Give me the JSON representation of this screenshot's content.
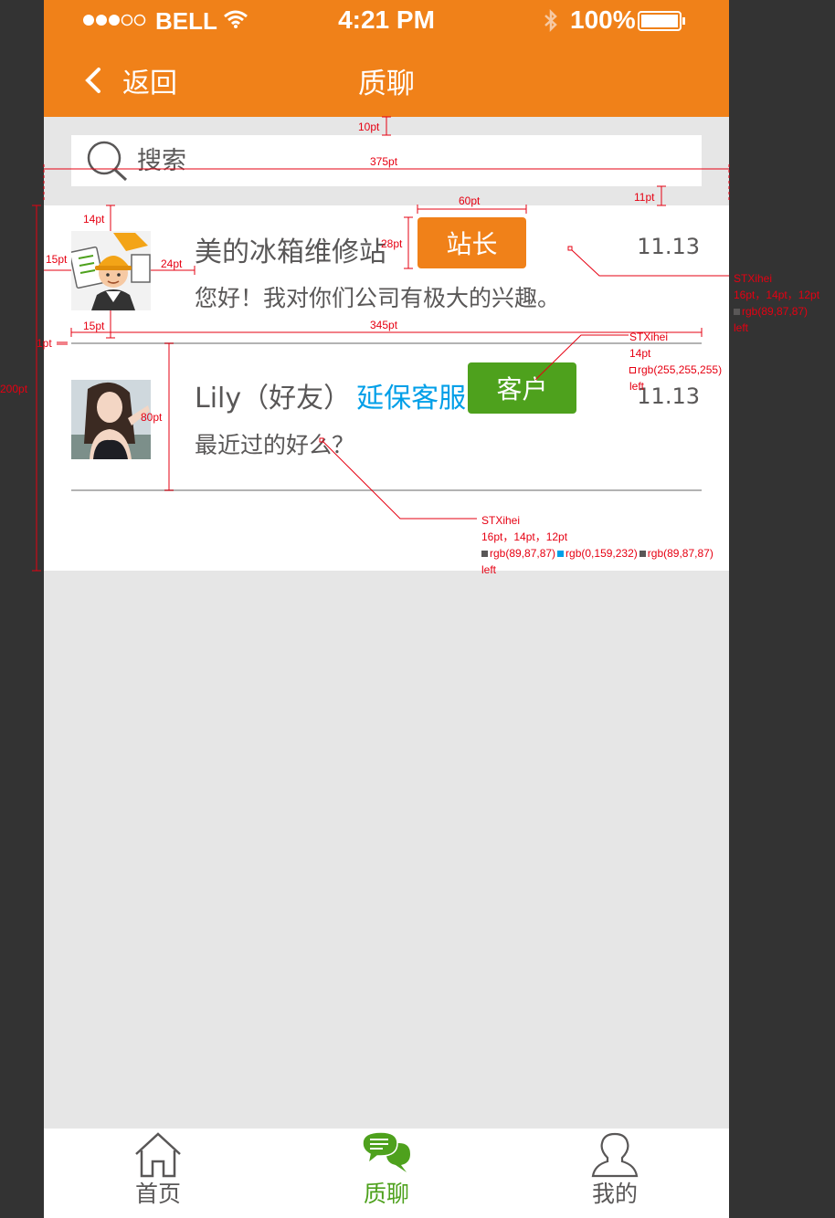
{
  "status_bar": {
    "carrier": "BELL",
    "time": "4:21 PM",
    "battery": "100%"
  },
  "nav": {
    "back_label": "返回",
    "title": "质聊"
  },
  "search": {
    "placeholder": "搜索"
  },
  "conversations": [
    {
      "name": "美的冰箱维修站",
      "role": "",
      "badge": "站长",
      "badge_color": "#f08119",
      "date": "11.13",
      "message": "您好！我对你们公司有极大的兴趣。"
    },
    {
      "name": "Lily（好友）",
      "role": "延保客服",
      "badge": "客户",
      "badge_color": "#4ea11d",
      "date": "11.13",
      "message": "最近过的好么？"
    }
  ],
  "tabs": [
    {
      "label": "首页",
      "icon": "home-icon",
      "active": false
    },
    {
      "label": "质聊",
      "icon": "chat-icon",
      "active": true
    },
    {
      "label": "我的",
      "icon": "user-icon",
      "active": false
    }
  ],
  "annotations": {
    "search_gap": "10pt",
    "width_total": "375pt",
    "badge_width": "60pt",
    "list_gap": "11pt",
    "avatar_top": "14pt",
    "avatar_left": "15pt",
    "avatar_gap": "24pt",
    "badge_height": "28pt",
    "avatar_bottom": "15pt",
    "row_width": "345pt",
    "divider_height": "1pt",
    "row_height": "80pt",
    "list_height": "200pt",
    "spec1": {
      "font": "STXihei",
      "size": "16pt，14pt，12pt",
      "color": "rgb(89,87,87)",
      "align": "left"
    },
    "spec2": {
      "font": "STXihei",
      "size": "14pt",
      "color": "rgb(255,255,255)",
      "align": "left"
    },
    "spec3": {
      "font": "STXihei",
      "size": "16pt，14pt，12pt",
      "color_a": "rgb(89,87,87)",
      "color_b": "rgb(0,159,232)",
      "color_c": "rgb(89,87,87)",
      "align": "left"
    }
  },
  "colors": {
    "brand": "#f08119",
    "green": "#4ea11d",
    "blue": "#009fe8",
    "text": "#595757"
  }
}
